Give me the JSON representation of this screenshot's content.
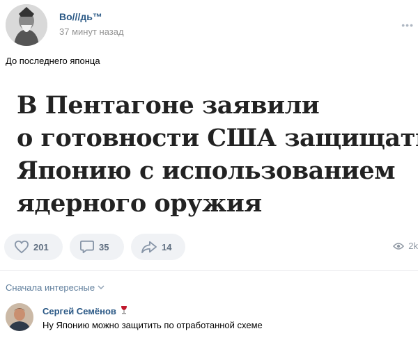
{
  "post": {
    "author": "Во///дь™",
    "time": "37 минут назад",
    "more_icon": "more-dots-icon",
    "text": "До последнего японца",
    "headline_lines": [
      "В Пентагоне заявили",
      "о готовности США защищать",
      "Японию с использованием",
      "ядерного оружия"
    ]
  },
  "actions": {
    "likes": "201",
    "comments": "35",
    "shares": "14",
    "views": "2k"
  },
  "comments_section": {
    "sort_label": "Сначала интересные",
    "comment": {
      "author": "Сергей Семёнов",
      "badge_icon": "wine-glass-icon",
      "text": "Ну Японию можно защитить по отработанной схеме"
    }
  },
  "colors": {
    "link": "#2a5885",
    "muted": "#939393",
    "button_bg": "#f0f2f5"
  }
}
